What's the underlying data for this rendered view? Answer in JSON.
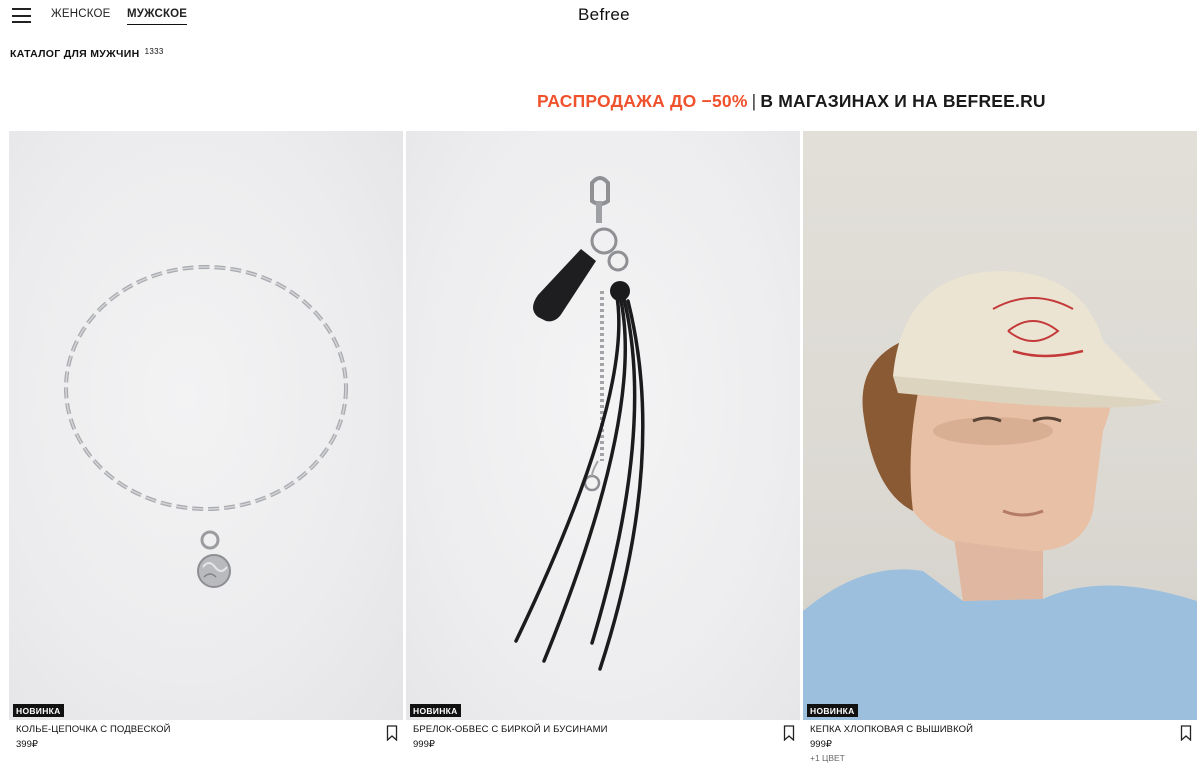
{
  "header": {
    "nav": {
      "women": "ЖЕНСКОЕ",
      "men": "МУЖСКОЕ"
    },
    "logo": "Befree"
  },
  "catalog": {
    "title": "КАТАЛОГ ДЛЯ МУЖЧИН",
    "count": "1333"
  },
  "promo": {
    "accent": "РАСПРОДАЖА ДО −50%",
    "separator": "|",
    "rest": "В МАГАЗИНАХ И НА BEFREE.RU",
    "accent_color": "#f0522d"
  },
  "products": [
    {
      "badge": "НОВИНКА",
      "name": "КОЛЬЕ-ЦЕПОЧКА С ПОДВЕСКОЙ",
      "price": "399₽",
      "colors": ""
    },
    {
      "badge": "НОВИНКА",
      "name": "БРЕЛОК-ОБВЕС С БИРКОЙ И БУСИНАМИ",
      "price": "999₽",
      "colors": ""
    },
    {
      "badge": "НОВИНКА",
      "name": "КЕПКА ХЛОПКОВАЯ С ВЫШИВКОЙ",
      "price": "999₽",
      "colors": "+1 ЦВЕТ"
    }
  ],
  "icons": {
    "menu": "hamburger-icon",
    "bookmark": "bookmark-icon"
  }
}
